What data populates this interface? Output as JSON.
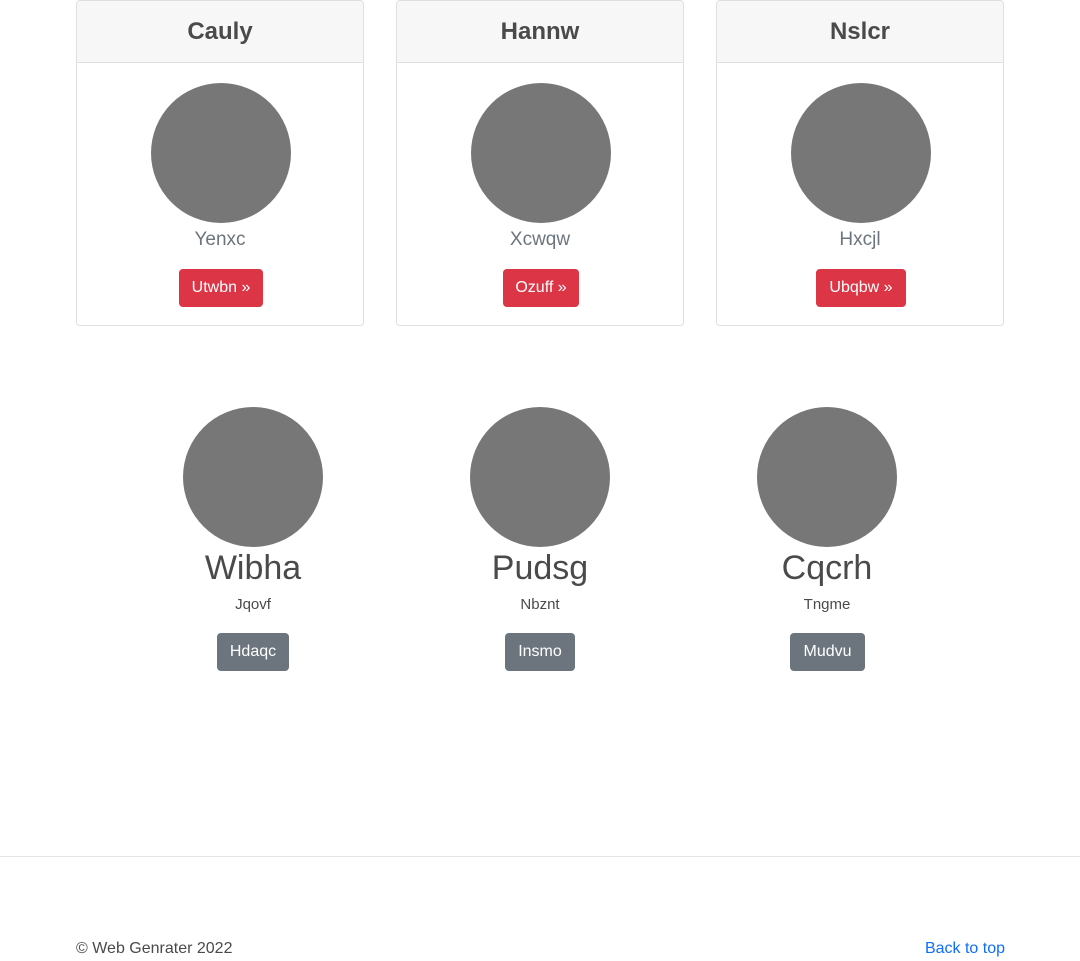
{
  "cards": [
    {
      "title": "Cauly",
      "subtitle": "Yenxc",
      "button": "Utwbn »"
    },
    {
      "title": "Hannw",
      "subtitle": "Xcwqw",
      "button": "Ozuff »"
    },
    {
      "title": "Nslcr",
      "subtitle": "Hxcjl",
      "button": "Ubqbw »"
    }
  ],
  "profiles": [
    {
      "name": "Wibha",
      "subtitle": "Jqovf",
      "button": "Hdaqc"
    },
    {
      "name": "Pudsg",
      "subtitle": "Nbznt",
      "button": "Insmo"
    },
    {
      "name": "Cqcrh",
      "subtitle": "Tngme",
      "button": "Mudvu"
    }
  ],
  "footer": {
    "copyright": "© Web Genrater 2022",
    "back_to_top": "Back to top"
  },
  "colors": {
    "danger": "#dc3545",
    "secondary": "#6c757d",
    "link": "#0d6efd",
    "avatar": "#777777"
  }
}
